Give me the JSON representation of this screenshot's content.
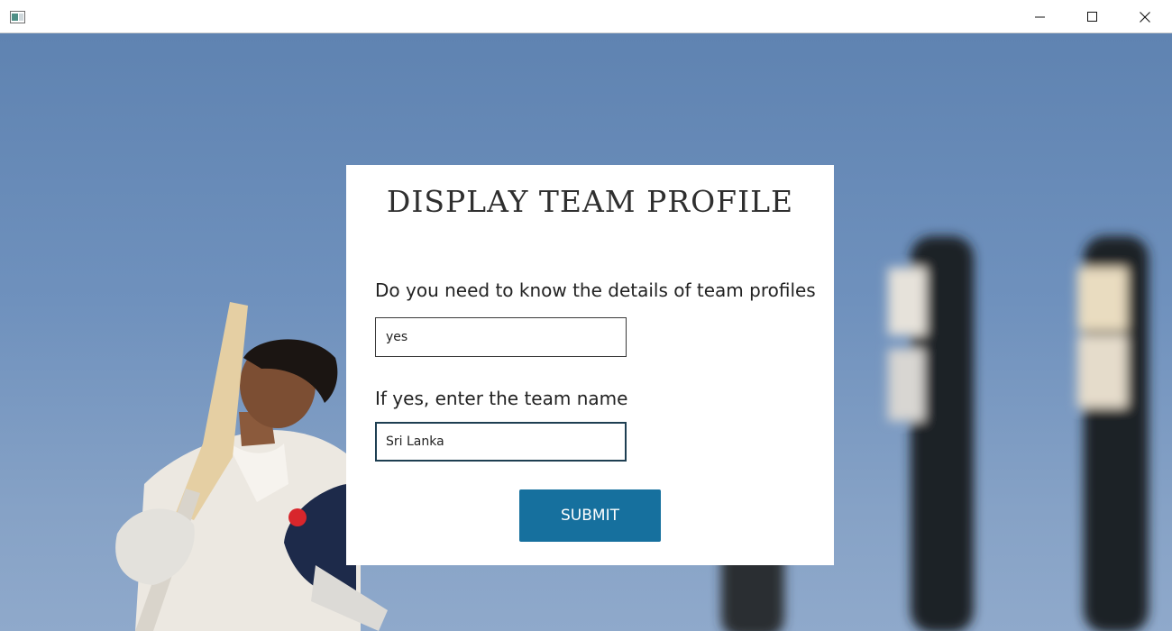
{
  "window": {
    "minimize_icon": "minimize-icon",
    "maximize_icon": "maximize-icon",
    "close_icon": "close-icon"
  },
  "form": {
    "title": "DISPLAY TEAM PROFILE",
    "question_label": "Do you need to know the details of team profiles",
    "question_value": "yes",
    "team_label": "If yes, enter the team name",
    "team_value": "Sri Lanka",
    "submit_label": "SUBMIT"
  },
  "colors": {
    "sky": "#6a8cba",
    "submit": "#16709e",
    "card": "#ffffff"
  }
}
